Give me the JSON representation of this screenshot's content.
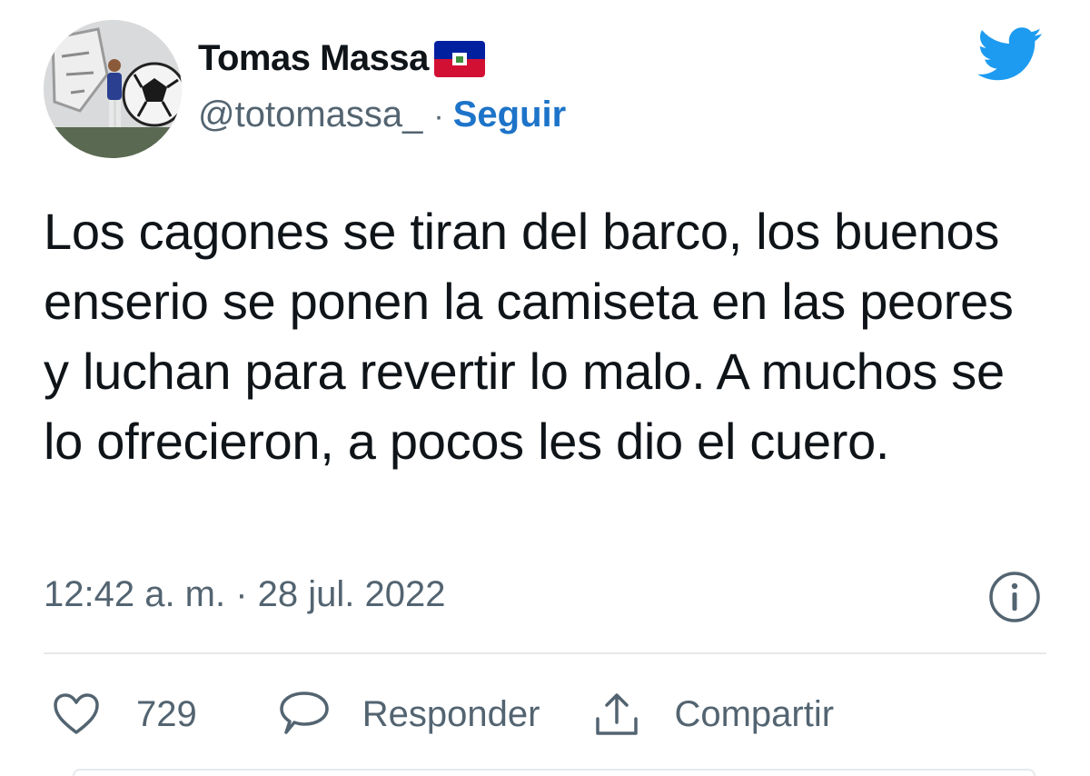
{
  "author": {
    "display_name": "Tomas Massa",
    "handle": "@totomassa_",
    "separator": "·",
    "follow_label": "Seguir"
  },
  "tweet": {
    "text": "Los cagones se tiran del barco, los buenos enserio se ponen la camiseta en las peores y luchan para revertir lo malo. A muchos se lo ofrecieron, a pocos les dio el cuero.",
    "timestamp": "12:42 a. m. · 28 jul. 2022"
  },
  "actions": {
    "like_count": "729",
    "reply_label": "Responder",
    "share_label": "Compartir"
  },
  "icons": {
    "brand": "twitter-bird-icon",
    "flag": "haiti-flag-icon",
    "info": "info-icon",
    "like": "heart-icon",
    "reply": "speech-bubble-icon",
    "share": "share-icon"
  },
  "colors": {
    "twitter_blue": "#1d9bf0",
    "follow_blue": "#1d74c9",
    "text_primary": "#0f1419",
    "text_secondary": "#536471",
    "divider": "#e6e9ec",
    "flag_blue": "#00209f",
    "flag_red": "#d21034"
  }
}
